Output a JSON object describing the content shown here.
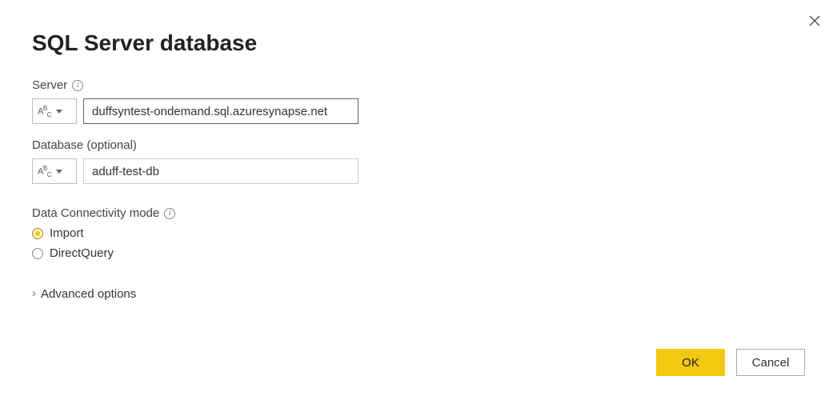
{
  "dialog": {
    "title": "SQL Server database"
  },
  "fields": {
    "server": {
      "label": "Server",
      "value": "duffsyntest-ondemand.sql.azuresynapse.net",
      "typeIndicator": "ABC"
    },
    "database": {
      "label": "Database (optional)",
      "value": "aduff-test-db",
      "typeIndicator": "ABC"
    }
  },
  "connectivity": {
    "label": "Data Connectivity mode",
    "options": {
      "import": "Import",
      "directQuery": "DirectQuery"
    },
    "selected": "import"
  },
  "advanced": {
    "label": "Advanced options"
  },
  "buttons": {
    "ok": "OK",
    "cancel": "Cancel"
  }
}
